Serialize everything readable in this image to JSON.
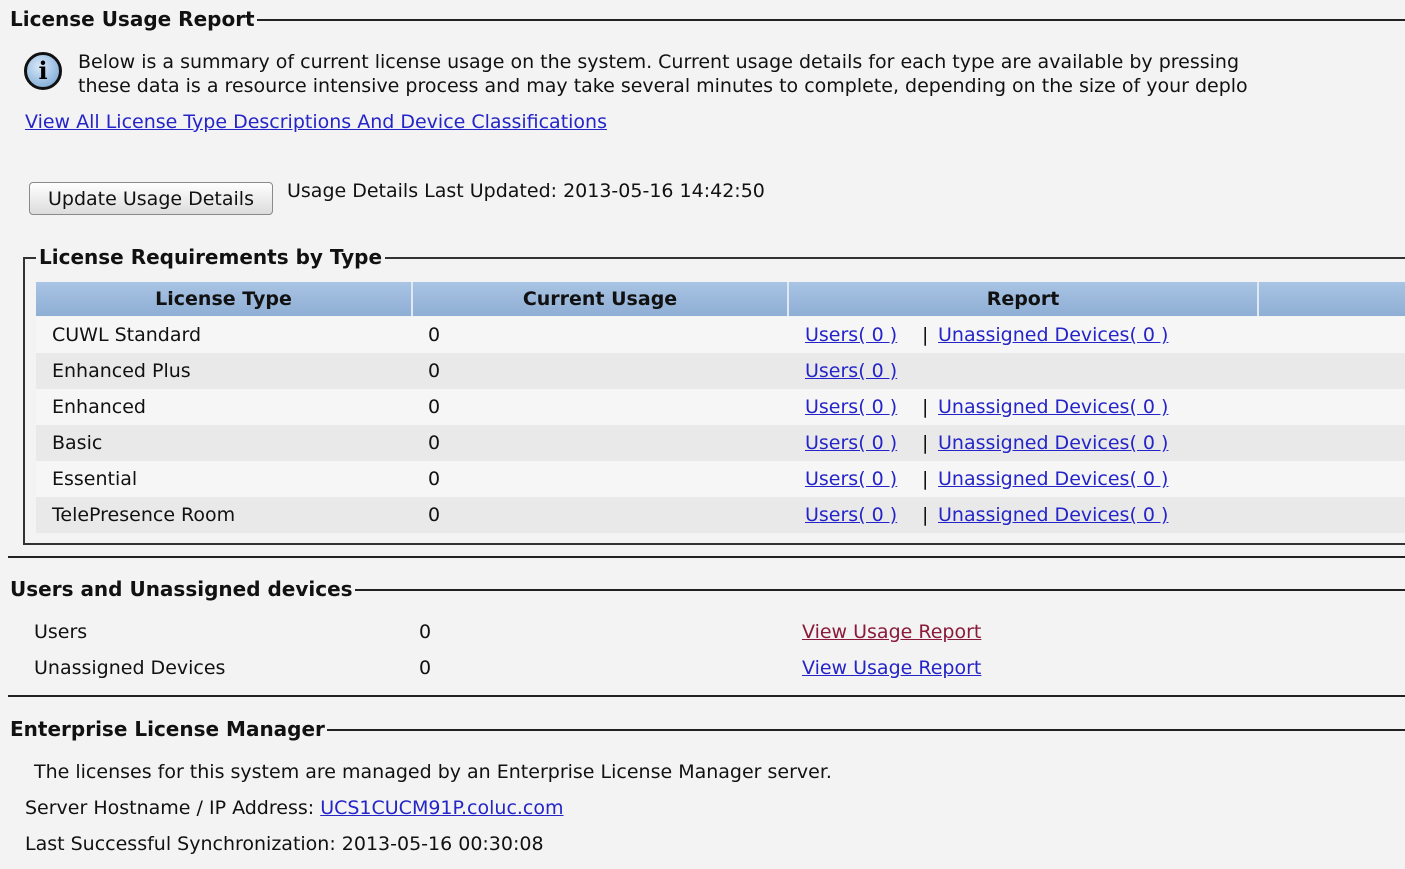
{
  "license_usage_report": {
    "title": "License Usage Report",
    "info_line1": "Below is a summary of current license usage on the system. Current usage details for each type are available by pressing",
    "info_line2": "these data is a resource intensive process and may take several minutes to complete, depending on the size of your deplo",
    "descriptions_link": "View All License Type Descriptions And Device Classifications",
    "update_button": "Update Usage Details",
    "last_updated": "Usage Details Last Updated: 2013-05-16 14:42:50"
  },
  "requirements": {
    "title": "License Requirements by Type",
    "columns": [
      "License Type",
      "Current Usage",
      "Report"
    ],
    "rows": [
      {
        "type": "CUWL Standard",
        "usage": "0",
        "users": "Users( 0 )",
        "sep": "|",
        "devices": "Unassigned Devices( 0 )"
      },
      {
        "type": "Enhanced Plus",
        "usage": "0",
        "users": "Users( 0 )",
        "sep": "",
        "devices": ""
      },
      {
        "type": "Enhanced",
        "usage": "0",
        "users": "Users( 0 )",
        "sep": "|",
        "devices": "Unassigned Devices( 0 )"
      },
      {
        "type": "Basic",
        "usage": "0",
        "users": "Users( 0 )",
        "sep": "|",
        "devices": "Unassigned Devices( 0 )"
      },
      {
        "type": "Essential",
        "usage": "0",
        "users": "Users( 0 )",
        "sep": "|",
        "devices": "Unassigned Devices( 0 )"
      },
      {
        "type": "TelePresence Room",
        "usage": "0",
        "users": "Users( 0 )",
        "sep": "|",
        "devices": "Unassigned Devices( 0 )"
      }
    ]
  },
  "users_devices": {
    "title": "Users and Unassigned devices",
    "rows": [
      {
        "label": "Users",
        "value": "0",
        "link": "View Usage Report"
      },
      {
        "label": "Unassigned Devices",
        "value": "0",
        "link": "View Usage Report"
      }
    ]
  },
  "elm": {
    "title": "Enterprise License Manager",
    "description": "The licenses for this system are managed by an Enterprise License Manager server.",
    "hostname_label": "Server Hostname / IP Address:",
    "hostname_value": "UCS1CUCM91P.coluc.com",
    "last_sync": "Last Successful Synchronization: 2013-05-16 00:30:08"
  },
  "colors": {
    "link": "#2424c8",
    "visited_link": "#8a1a3a",
    "header_bg": "#9fbbdf"
  }
}
